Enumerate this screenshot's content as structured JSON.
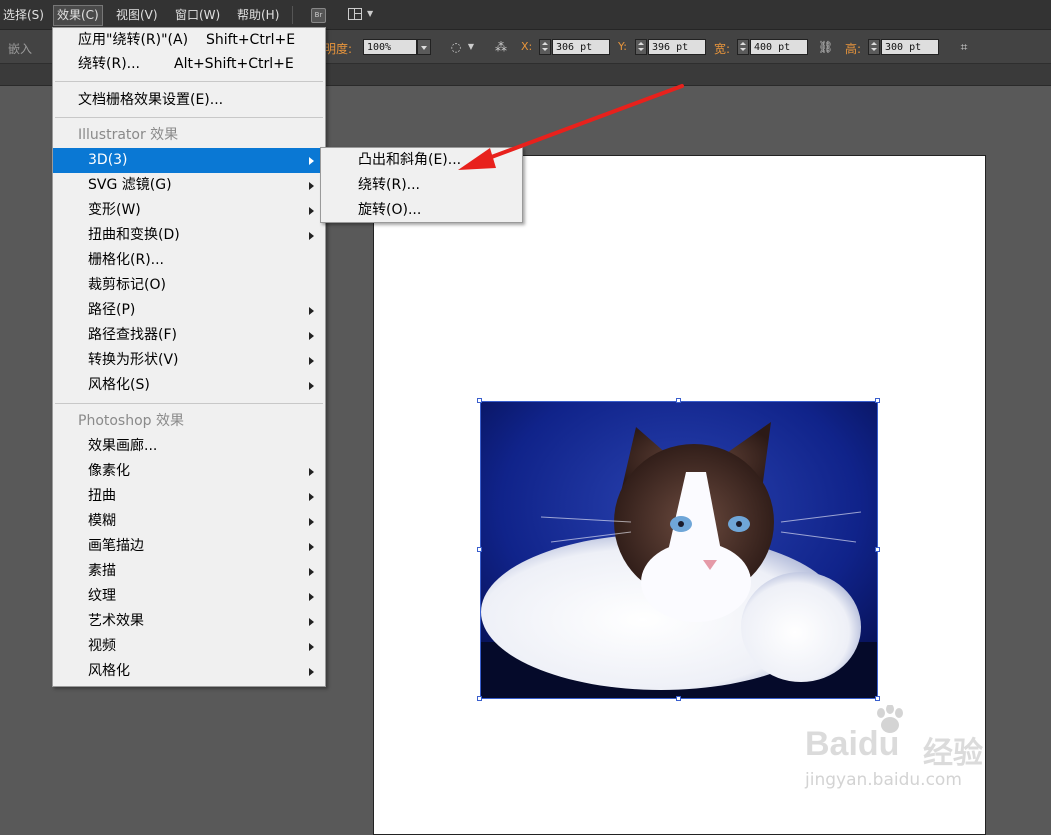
{
  "menubar": {
    "items": [
      "选择(S)",
      "效果(C)",
      "视图(V)",
      "窗口(W)",
      "帮助(H)"
    ],
    "br_label": "Br"
  },
  "control_bar": {
    "embed_label": "嵌入",
    "opacity_label": "不透明度:",
    "opacity_value": "100%",
    "x_label": "X:",
    "x_value": "306 pt",
    "y_label": "Y:",
    "y_value": "396 pt",
    "width_label": "宽:",
    "width_value": "400 pt",
    "height_label": "高:",
    "height_value": "300 pt"
  },
  "effect_menu": {
    "items": [
      {
        "label": "应用\"绕转(R)\"(A)",
        "shortcut": "Shift+Ctrl+E"
      },
      {
        "label": "绕转(R)...",
        "shortcut": "Alt+Shift+Ctrl+E"
      },
      {
        "label": "文档栅格效果设置(E)..."
      },
      {
        "label": "Illustrator 效果"
      },
      {
        "label": "3D(3)"
      },
      {
        "label": "SVG 滤镜(G)"
      },
      {
        "label": "变形(W)"
      },
      {
        "label": "扭曲和变换(D)"
      },
      {
        "label": "栅格化(R)..."
      },
      {
        "label": "裁剪标记(O)"
      },
      {
        "label": "路径(P)"
      },
      {
        "label": "路径查找器(F)"
      },
      {
        "label": "转换为形状(V)"
      },
      {
        "label": "风格化(S)"
      },
      {
        "label": "Photoshop 效果"
      },
      {
        "label": "效果画廊..."
      },
      {
        "label": "像素化"
      },
      {
        "label": "扭曲"
      },
      {
        "label": "模糊"
      },
      {
        "label": "画笔描边"
      },
      {
        "label": "素描"
      },
      {
        "label": "纹理"
      },
      {
        "label": "艺术效果"
      },
      {
        "label": "视频"
      },
      {
        "label": "风格化"
      }
    ]
  },
  "submenu_3d": {
    "items": [
      "凸出和斜角(E)...",
      "绕转(R)...",
      "旋转(O)..."
    ]
  },
  "watermark": {
    "brand": "Baidu",
    "brand_cn": "经验",
    "url": "jingyan.baidu.com"
  },
  "colors": {
    "highlight": "#0a78d4",
    "arrow": "#e8211c",
    "selection": "#3a5fcd"
  }
}
